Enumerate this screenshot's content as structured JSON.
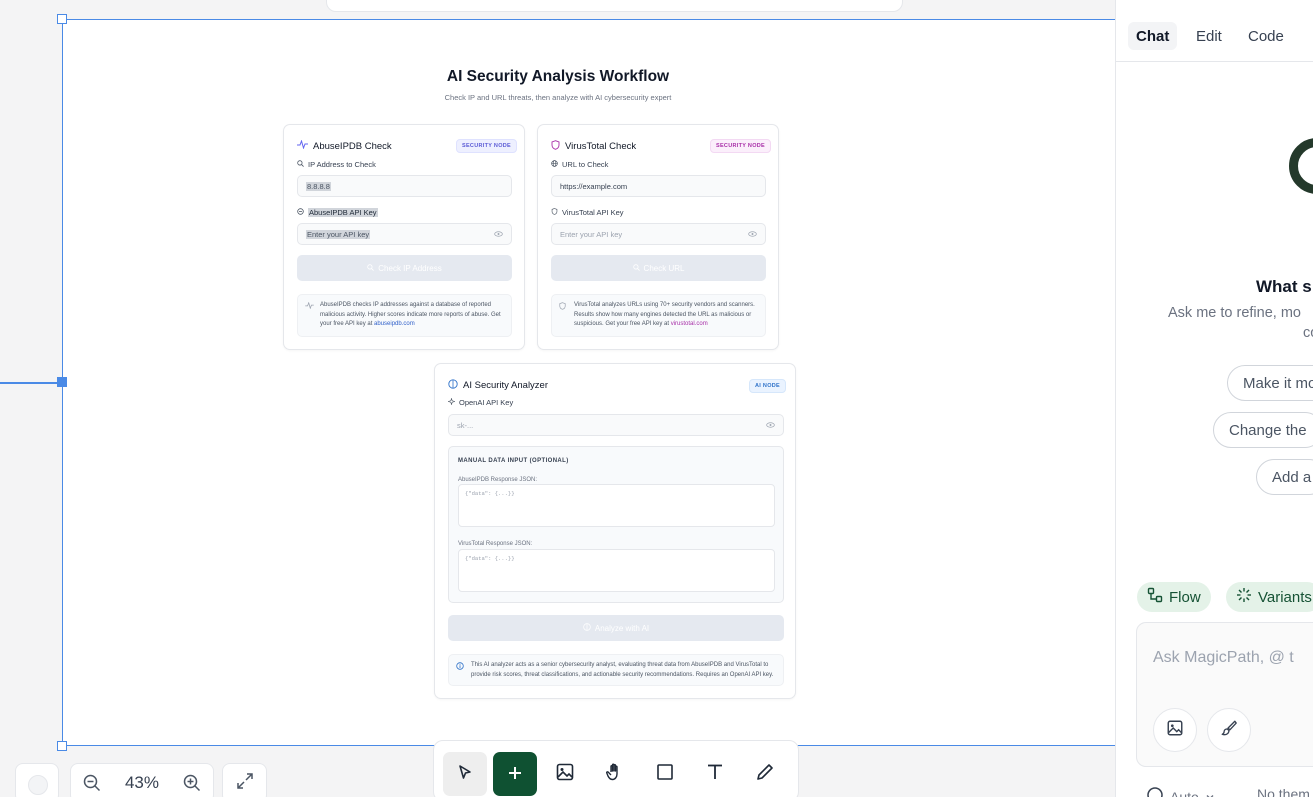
{
  "workflow": {
    "title": "AI Security Analysis Workflow",
    "subtitle": "Check IP and URL threats, then analyze with AI cybersecurity expert"
  },
  "abuse_card": {
    "title": "AbuseIPDB Check",
    "tag": "SECURITY NODE",
    "ip_label": "IP Address to Check",
    "ip_value": "8.8.8.8",
    "key_label": "AbuseIPDB API Key",
    "key_placeholder": "Enter your API key",
    "button": "Check IP Address",
    "info_text": "AbuseIPDB checks IP addresses against a database of reported malicious activity. Higher scores indicate more reports of abuse. Get your free API key at",
    "info_link": "abuseipdb.com"
  },
  "virus_card": {
    "title": "VirusTotal Check",
    "tag": "SECURITY NODE",
    "url_label": "URL to Check",
    "url_value": "https://example.com",
    "key_label": "VirusTotal API Key",
    "key_placeholder": "Enter your API key",
    "button": "Check URL",
    "info_text": "VirusTotal analyzes URLs using 70+ security vendors and scanners. Results show how many engines detected the URL as malicious or suspicious. Get your free API key at",
    "info_link": "virustotal.com"
  },
  "ai_card": {
    "title": "AI Security Analyzer",
    "tag": "AI NODE",
    "key_label": "OpenAI API Key",
    "key_placeholder": "sk-...",
    "manual_header": "MANUAL DATA INPUT (OPTIONAL)",
    "abuse_json_label": "AbuseIPDB Response JSON:",
    "abuse_json_placeholder": "{\"data\": {...}}",
    "virus_json_label": "VirusTotal Response JSON:",
    "virus_json_placeholder": "{\"data\": {...}}",
    "button": "Analyze with AI",
    "info_text": "This AI analyzer acts as a senior cybersecurity analyst, evaluating threat data from AbuseIPDB and VirusTotal to provide risk scores, threat classifications, and actionable security recommendations. Requires an OpenAI API key."
  },
  "zoom": {
    "level": "43%"
  },
  "toolbar": {
    "tools": [
      "select-tool",
      "add-tool",
      "image-tool",
      "hand-tool",
      "rectangle-tool",
      "text-tool",
      "pen-tool"
    ],
    "accent": "#0f5132"
  },
  "panel": {
    "tabs": [
      "Chat",
      "Edit",
      "Code"
    ],
    "active_tab": "Chat",
    "heading": "What s",
    "subtext_line1": "Ask me to refine, mo",
    "subtext_line2": "co",
    "suggestions": [
      "Make it mo",
      "Change the",
      "Add a"
    ],
    "chips": [
      "Flow",
      "Variants"
    ],
    "input_placeholder": "Ask MagicPath, @ t",
    "footer_left": "Auto",
    "footer_right": "No them"
  },
  "colors": {
    "selection": "#4a8ae6",
    "brand_green": "#0f5132",
    "chip_bg": "#e4f2e8"
  }
}
